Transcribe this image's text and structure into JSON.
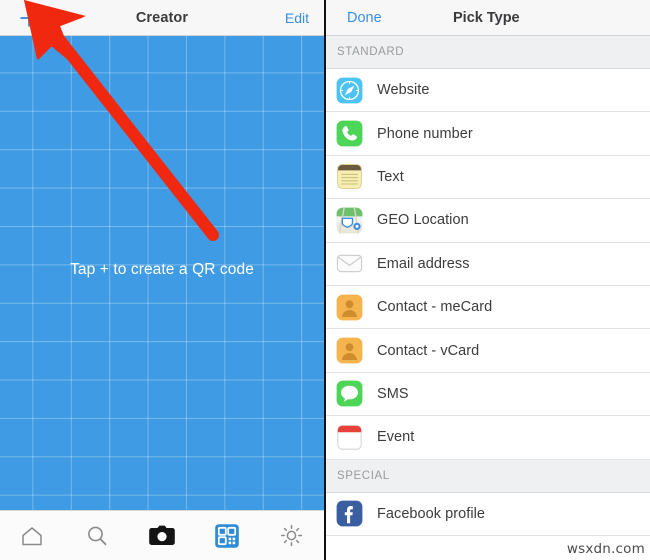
{
  "left": {
    "nav": {
      "add_icon": "plus-icon",
      "title": "Creator",
      "edit_label": "Edit"
    },
    "canvas": {
      "hint": "Tap + to create a QR code",
      "background_color": "#3f9be3",
      "grid_line_color": "#ffffff",
      "annotation_arrow_color": "#f02810"
    },
    "tabs": [
      {
        "name": "home",
        "icon": "home-icon",
        "selected": false
      },
      {
        "name": "search",
        "icon": "search-icon",
        "selected": false
      },
      {
        "name": "camera",
        "icon": "camera-icon",
        "selected": false
      },
      {
        "name": "qr-code",
        "icon": "qr-code-icon",
        "selected": true
      },
      {
        "name": "settings",
        "icon": "gear-icon",
        "selected": false
      }
    ]
  },
  "right": {
    "nav": {
      "done_label": "Done",
      "title": "Pick Type"
    },
    "sections": [
      {
        "header": "STANDARD",
        "items": [
          {
            "label": "Website",
            "icon": "safari-compass-icon"
          },
          {
            "label": "Phone number",
            "icon": "phone-icon"
          },
          {
            "label": "Text",
            "icon": "notes-icon"
          },
          {
            "label": "GEO Location",
            "icon": "maps-icon"
          },
          {
            "label": "Email address",
            "icon": "envelope-icon"
          },
          {
            "label": "Contact - meCard",
            "icon": "contact-person-icon"
          },
          {
            "label": "Contact - vCard",
            "icon": "contact-person-icon"
          },
          {
            "label": "SMS",
            "icon": "message-bubble-icon"
          },
          {
            "label": "Event",
            "icon": "calendar-icon"
          }
        ]
      },
      {
        "header": "SPECIAL",
        "items": [
          {
            "label": "Facebook profile",
            "icon": "facebook-icon"
          }
        ]
      }
    ]
  },
  "watermark": "wsxdn.com",
  "colors": {
    "accent_blue": "#3b8fe0",
    "nav_background": "#f7f7f8",
    "section_header_background": "#eff0f2",
    "selected_tab": "#2e8bd6"
  }
}
